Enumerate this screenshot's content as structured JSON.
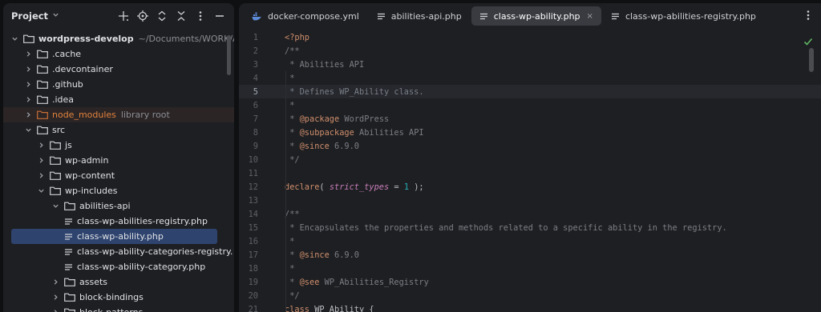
{
  "project": {
    "title": "Project",
    "tools": [
      "add-icon",
      "locate-icon",
      "expand-all-icon",
      "collapse-all-icon",
      "more-icon",
      "hide-icon"
    ],
    "tree": [
      {
        "label": "wordpress-develop",
        "hint": "~/Documents/WORK/Authlab",
        "depth": 0,
        "type": "folder",
        "open": true,
        "bold": true
      },
      {
        "label": ".cache",
        "depth": 1,
        "type": "folder",
        "open": false
      },
      {
        "label": ".devcontainer",
        "depth": 1,
        "type": "folder",
        "open": false
      },
      {
        "label": ".github",
        "depth": 1,
        "type": "folder",
        "open": false
      },
      {
        "label": ".idea",
        "depth": 1,
        "type": "folder",
        "open": false
      },
      {
        "label": "node_modules",
        "hint": "library root",
        "depth": 1,
        "type": "folder-excluded",
        "open": false
      },
      {
        "label": "src",
        "depth": 1,
        "type": "folder",
        "open": true
      },
      {
        "label": "js",
        "depth": 2,
        "type": "folder",
        "open": false
      },
      {
        "label": "wp-admin",
        "depth": 2,
        "type": "folder",
        "open": false
      },
      {
        "label": "wp-content",
        "depth": 2,
        "type": "folder",
        "open": false
      },
      {
        "label": "wp-includes",
        "depth": 2,
        "type": "folder",
        "open": true
      },
      {
        "label": "abilities-api",
        "depth": 3,
        "type": "folder",
        "open": true
      },
      {
        "label": "class-wp-abilities-registry.php",
        "depth": 4,
        "type": "file"
      },
      {
        "label": "class-wp-ability.php",
        "depth": 4,
        "type": "file",
        "selected": true
      },
      {
        "label": "class-wp-ability-categories-registry.",
        "depth": 4,
        "type": "file"
      },
      {
        "label": "class-wp-ability-category.php",
        "depth": 4,
        "type": "file"
      },
      {
        "label": "assets",
        "depth": 3,
        "type": "folder",
        "open": false
      },
      {
        "label": "block-bindings",
        "depth": 3,
        "type": "folder",
        "open": false
      },
      {
        "label": "block-patterns",
        "depth": 3,
        "type": "folder",
        "open": false
      }
    ]
  },
  "editor": {
    "tabs": [
      {
        "label": "docker-compose.yml",
        "icon": "docker-icon",
        "active": false
      },
      {
        "label": "abilities-api.php",
        "icon": "file-icon",
        "active": false
      },
      {
        "label": "class-wp-ability.php",
        "icon": "file-icon",
        "active": true,
        "close": "×"
      },
      {
        "label": "class-wp-abilities-registry.php",
        "icon": "file-icon",
        "active": false
      }
    ],
    "current_line": 5,
    "lines": [
      {
        "n": "1",
        "tokens": [
          {
            "t": "<?php",
            "c": "tag"
          }
        ]
      },
      {
        "n": "2",
        "tokens": [
          {
            "t": "/**",
            "c": "comment"
          }
        ]
      },
      {
        "n": "3",
        "tokens": [
          {
            "t": " * Abilities API",
            "c": "comment"
          }
        ]
      },
      {
        "n": "4",
        "tokens": [
          {
            "t": " *",
            "c": "comment"
          }
        ]
      },
      {
        "n": "5",
        "tokens": [
          {
            "t": " * Defines WP_Ability class.",
            "c": "comment"
          }
        ]
      },
      {
        "n": "6",
        "tokens": [
          {
            "t": " *",
            "c": "comment"
          }
        ]
      },
      {
        "n": "7",
        "tokens": [
          {
            "t": " * ",
            "c": "comment"
          },
          {
            "t": "@package",
            "c": "key"
          },
          {
            "t": " WordPress",
            "c": "comment"
          }
        ]
      },
      {
        "n": "8",
        "tokens": [
          {
            "t": " * ",
            "c": "comment"
          },
          {
            "t": "@subpackage",
            "c": "key"
          },
          {
            "t": " Abilities API",
            "c": "comment"
          }
        ]
      },
      {
        "n": "9",
        "tokens": [
          {
            "t": " * ",
            "c": "comment"
          },
          {
            "t": "@since",
            "c": "key"
          },
          {
            "t": " 6.9.0",
            "c": "comment"
          }
        ]
      },
      {
        "n": "10",
        "tokens": [
          {
            "t": " */",
            "c": "comment"
          }
        ]
      },
      {
        "n": "11",
        "tokens": []
      },
      {
        "n": "12",
        "tokens": [
          {
            "t": "declare",
            "c": "key"
          },
          {
            "t": "( ",
            "c": "plain"
          },
          {
            "t": "strict_types",
            "c": "param"
          },
          {
            "t": " = ",
            "c": "plain"
          },
          {
            "t": "1",
            "c": "num"
          },
          {
            "t": " );",
            "c": "plain"
          }
        ]
      },
      {
        "n": "13",
        "tokens": []
      },
      {
        "n": "14",
        "tokens": [
          {
            "t": "/**",
            "c": "comment"
          }
        ]
      },
      {
        "n": "15",
        "tokens": [
          {
            "t": " * Encapsulates the properties and methods related to a specific ability in the registry.",
            "c": "comment"
          }
        ]
      },
      {
        "n": "16",
        "tokens": [
          {
            "t": " *",
            "c": "comment"
          }
        ]
      },
      {
        "n": "17",
        "tokens": [
          {
            "t": " * ",
            "c": "comment"
          },
          {
            "t": "@since",
            "c": "key"
          },
          {
            "t": " 6.9.0",
            "c": "comment"
          }
        ]
      },
      {
        "n": "18",
        "tokens": [
          {
            "t": " *",
            "c": "comment"
          }
        ]
      },
      {
        "n": "19",
        "tokens": [
          {
            "t": " * ",
            "c": "comment"
          },
          {
            "t": "@see",
            "c": "key"
          },
          {
            "t": " WP_Abilities_Registry",
            "c": "comment"
          }
        ]
      },
      {
        "n": "20",
        "tokens": [
          {
            "t": " */",
            "c": "comment"
          }
        ]
      },
      {
        "n": "21",
        "tokens": [
          {
            "t": "class",
            "c": "key"
          },
          {
            "t": " WP_Ability {",
            "c": "plain"
          }
        ]
      }
    ]
  }
}
